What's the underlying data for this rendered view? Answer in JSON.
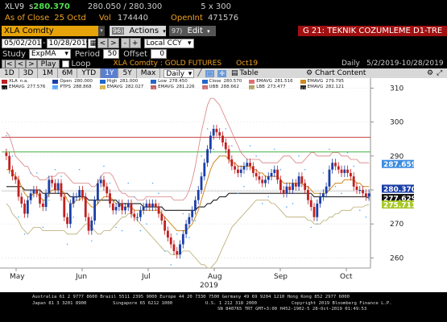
{
  "quote": {
    "ticker": "XLV9",
    "price_prefix": "s",
    "price": "280.370",
    "bid_ask": "280.050 / 280.300",
    "size": "5 x 300",
    "asof_label": "As of Close",
    "asof_date": "25 Oct",
    "asof_flag": "d",
    "vol_label": "Vol",
    "vol": "174440",
    "oi_label": "OpenInt",
    "oi": "471576"
  },
  "toolbar": {
    "security": "XLA  Comdty",
    "actions_num": "96)",
    "actions": "Actions",
    "edit_num": "97)",
    "edit": "Edit",
    "page_title": "G 21: TEKNIK COZUMLEME D1-TRE"
  },
  "range": {
    "start": "05/02/2019",
    "end": "10/28/2019",
    "currency": "Local CCY"
  },
  "study": {
    "label": "Study",
    "value": "ExpMA",
    "period_label": "Period",
    "period": "50",
    "offset_label": "Offset",
    "offset": "0"
  },
  "playback": {
    "play": "Play",
    "loop": "Loop",
    "chart_name": "XLA  Comdty : GOLD FUTURES",
    "contract": "Oct19",
    "freq": "Daily",
    "date_range": "5/2/2019-10/28/2019"
  },
  "tabs": [
    "1D",
    "3D",
    "1M",
    "6M",
    "YTD",
    "1Y",
    "5Y",
    "Max"
  ],
  "selected_tab": "1Y",
  "controls": {
    "period_select": "Daily",
    "table": "Table",
    "chart_content": "Chart Content"
  },
  "legend": [
    {
      "name": "XLA",
      "value": "n.a.",
      "color": "#c02020"
    },
    {
      "name": "Open",
      "value": "280.000",
      "color": "#1a3ea8"
    },
    {
      "name": "High",
      "value": "281.000",
      "color": "#2266cc"
    },
    {
      "name": "Low",
      "value": "278.450",
      "color": "#2266cc"
    },
    {
      "name": "Close",
      "value": "280.570",
      "color": "#2266cc"
    },
    {
      "name": "EMAVG",
      "value": "281.516",
      "color": "#e07070"
    },
    {
      "name": "EMAVG",
      "value": "279.795",
      "color": "#d08a20"
    },
    {
      "name": "EMAVG",
      "value": "277.576",
      "color": "#111111"
    },
    {
      "name": "PTPS",
      "value": "288.868",
      "color": "#55aaff"
    },
    {
      "name": "EMAVG",
      "value": "282.027",
      "color": "#d9b44a"
    },
    {
      "name": "EMAVG",
      "value": "281.226",
      "color": "#c06060"
    },
    {
      "name": "UBB",
      "value": "288.662",
      "color": "#c87070"
    },
    {
      "name": "LBB",
      "value": "273.477",
      "color": "#b0a060"
    },
    {
      "name": "EMAVG",
      "value": "282.121",
      "color": "#2a2a2a"
    }
  ],
  "price_tags": [
    {
      "value": "287.659",
      "color": "#3a8be0"
    },
    {
      "value": "280.370",
      "color": "#1a3ea8"
    },
    {
      "value": "277.629",
      "color": "#111111"
    },
    {
      "value": "275.711",
      "color": "#a8c82a"
    }
  ],
  "chart_data": {
    "type": "candlestick",
    "y_ticks": [
      260,
      270,
      280,
      290,
      300,
      310
    ],
    "ylim": [
      257,
      312
    ],
    "x_month_labels": [
      "May",
      "Jun",
      "Jul",
      "Aug",
      "Sep",
      "Oct"
    ],
    "year_label": "2019",
    "horizontal_lines": [
      {
        "name": "resistance",
        "value": 295.5,
        "color": "#c03030"
      },
      {
        "name": "upper-band",
        "value": 291.2,
        "color": "#40b040"
      },
      {
        "name": "reference",
        "value": 279.7,
        "color": "#d0d0d0"
      }
    ],
    "closes": [
      290,
      286,
      284,
      283,
      278,
      276,
      273,
      277,
      279,
      280,
      279,
      276,
      275,
      279,
      283,
      282,
      280,
      282,
      278,
      272,
      270,
      276,
      278,
      278,
      280,
      278,
      272,
      268,
      271,
      277,
      282,
      283,
      281,
      279,
      276,
      274,
      275,
      276,
      274,
      275,
      276,
      273,
      272,
      272,
      274,
      275,
      276,
      275,
      276,
      275,
      273,
      271,
      268,
      266,
      264,
      262,
      261,
      264,
      267,
      270,
      272,
      274,
      277,
      280,
      284,
      288,
      292,
      296,
      298,
      297,
      296,
      294,
      292,
      289,
      287,
      286,
      285,
      286,
      287,
      288,
      287,
      285,
      284,
      283,
      282,
      283,
      284,
      285,
      286,
      283,
      280,
      279,
      281,
      280,
      282,
      281,
      284,
      282,
      280,
      277,
      275,
      272,
      276,
      278,
      279,
      281,
      286,
      288,
      287,
      286,
      285,
      286,
      285,
      284,
      281,
      280,
      280,
      279,
      278,
      279
    ],
    "ema_short": [
      286,
      286,
      285,
      284,
      283,
      281,
      279,
      278,
      278,
      279,
      279,
      278,
      277,
      277,
      279,
      280,
      280,
      280,
      280,
      279,
      277,
      276,
      276,
      277,
      277,
      278,
      277,
      276,
      275,
      275,
      276,
      277,
      278,
      278,
      278,
      277,
      276,
      276,
      275,
      275,
      275,
      275,
      274,
      274,
      274,
      274,
      274,
      274,
      274,
      274,
      274,
      273,
      272,
      271,
      270,
      269,
      268,
      268,
      268,
      268,
      269,
      270,
      272,
      274,
      277,
      280,
      283,
      286,
      288,
      289,
      290,
      290,
      290,
      289,
      288,
      288,
      287,
      287,
      287,
      287,
      287,
      286,
      286,
      285,
      285,
      284,
      284,
      284,
      284,
      284,
      283,
      282,
      282,
      282,
      282,
      282,
      282,
      282,
      281,
      281,
      280,
      279,
      279,
      279,
      279,
      279,
      280,
      281,
      282,
      282,
      282,
      283,
      283,
      283,
      283,
      282,
      282,
      281,
      281,
      281
    ],
    "ema_long": [
      281,
      281,
      281,
      281,
      281,
      281,
      280,
      280,
      280,
      280,
      280,
      280,
      279,
      279,
      279,
      279,
      279,
      279,
      279,
      279,
      279,
      278,
      278,
      278,
      278,
      278,
      278,
      277,
      277,
      277,
      277,
      277,
      277,
      277,
      277,
      277,
      277,
      276,
      276,
      276,
      276,
      276,
      276,
      276,
      276,
      275,
      275,
      275,
      275,
      275,
      275,
      275,
      274,
      274,
      274,
      274,
      274,
      274,
      274,
      274,
      274,
      274,
      274,
      275,
      275,
      275,
      276,
      276,
      277,
      277,
      278,
      278,
      278,
      279,
      279,
      279,
      279,
      279,
      279,
      279,
      279,
      279,
      279,
      279,
      279,
      279,
      279,
      279,
      279,
      279,
      279,
      279,
      279,
      279,
      279,
      279,
      279,
      279,
      279,
      279,
      279,
      278,
      278,
      278,
      278,
      278,
      278,
      278,
      278,
      278,
      278,
      278,
      278,
      278,
      278,
      278,
      278,
      278,
      278,
      277.6
    ],
    "ubb": [
      297,
      296,
      293,
      290,
      289,
      288,
      287,
      287,
      285,
      284,
      284,
      283,
      283,
      283,
      284,
      284,
      284,
      285,
      285,
      285,
      284,
      283,
      282,
      282,
      282,
      282,
      282,
      282,
      281,
      281,
      282,
      284,
      285,
      285,
      285,
      284,
      282,
      280,
      279,
      279,
      278,
      278,
      278,
      277,
      277,
      277,
      278,
      278,
      278,
      278,
      278,
      278,
      278,
      278,
      278,
      277,
      277,
      277,
      277,
      278,
      280,
      283,
      287,
      292,
      297,
      301,
      305,
      307,
      307,
      306,
      305,
      303,
      301,
      299,
      297,
      295,
      293,
      291,
      290,
      289,
      289,
      289,
      289,
      289,
      288,
      288,
      288,
      288,
      288,
      288,
      289,
      290,
      290,
      290,
      289,
      288,
      288,
      288,
      289,
      290,
      291,
      291,
      290,
      290,
      290,
      290,
      290,
      291,
      291,
      291,
      290,
      290,
      290,
      289,
      289,
      289,
      288,
      288,
      288,
      288
    ],
    "lbb": [
      276,
      275,
      273,
      272,
      271,
      269,
      268,
      267,
      268,
      269,
      269,
      269,
      268,
      268,
      268,
      268,
      268,
      268,
      268,
      268,
      267,
      267,
      267,
      267,
      268,
      269,
      270,
      270,
      269,
      268,
      267,
      267,
      268,
      268,
      268,
      269,
      270,
      271,
      272,
      272,
      273,
      273,
      272,
      271,
      270,
      269,
      268,
      267,
      266,
      265,
      264,
      263,
      262,
      262,
      261,
      261,
      261,
      261,
      262,
      262,
      262,
      261,
      260,
      259,
      258,
      258,
      257,
      257,
      258,
      259,
      261,
      263,
      265,
      267,
      269,
      270,
      271,
      272,
      273,
      274,
      275,
      276,
      277,
      277,
      277,
      277,
      277,
      276,
      276,
      275,
      274,
      273,
      272,
      272,
      272,
      272,
      272,
      272,
      272,
      271,
      271,
      270,
      270,
      270,
      271,
      271,
      272,
      272,
      273,
      273,
      274,
      274,
      274,
      274,
      275,
      275,
      275,
      275,
      275.5,
      275.7
    ]
  },
  "footer": {
    "line1": "Australia 61 2 9777 8600 Brazil 5511 2395 9000 Europe 44 20 7330 7500 Germany 49 69 9204 1210 Hong Kong 852 2977 6000",
    "line2_left": "Japan 81 3 3201 8900",
    "line2_mid": "Singapore 65 6212 1000",
    "line2_right": "U.S. 1 212 318 2000",
    "line2_copy": "Copyright 2019 Bloomberg Finance L.P.",
    "line3": "SN 840765 TRT  GMT+3:00 H452-1902-5 28-Oct-2019 01:49:53"
  }
}
